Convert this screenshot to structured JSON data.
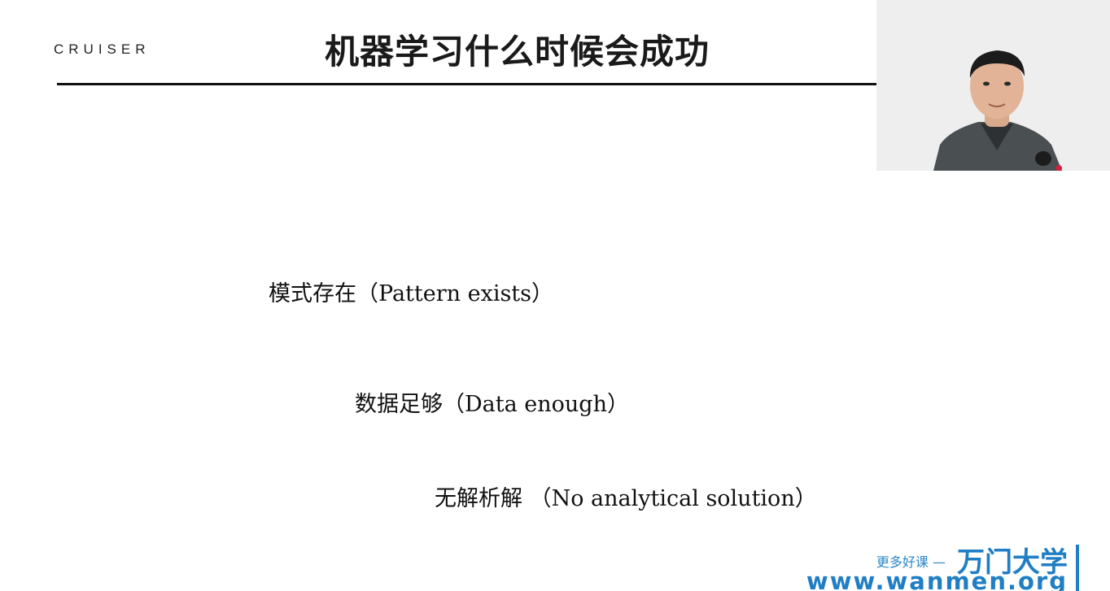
{
  "slide": {
    "logo_text": "CRUISER",
    "title": "机器学习什么时候会成功",
    "points": [
      "模式存在（Pattern exists）",
      "数据足够（Data enough）",
      "无解析解 （No analytical solution）"
    ]
  },
  "watermark": {
    "tagline": "更多好课 —",
    "brand": "万门大学",
    "url": "www.wanmen.org",
    "color": "#1f7ec4"
  },
  "webcam": {
    "icon": "presenter-video"
  }
}
